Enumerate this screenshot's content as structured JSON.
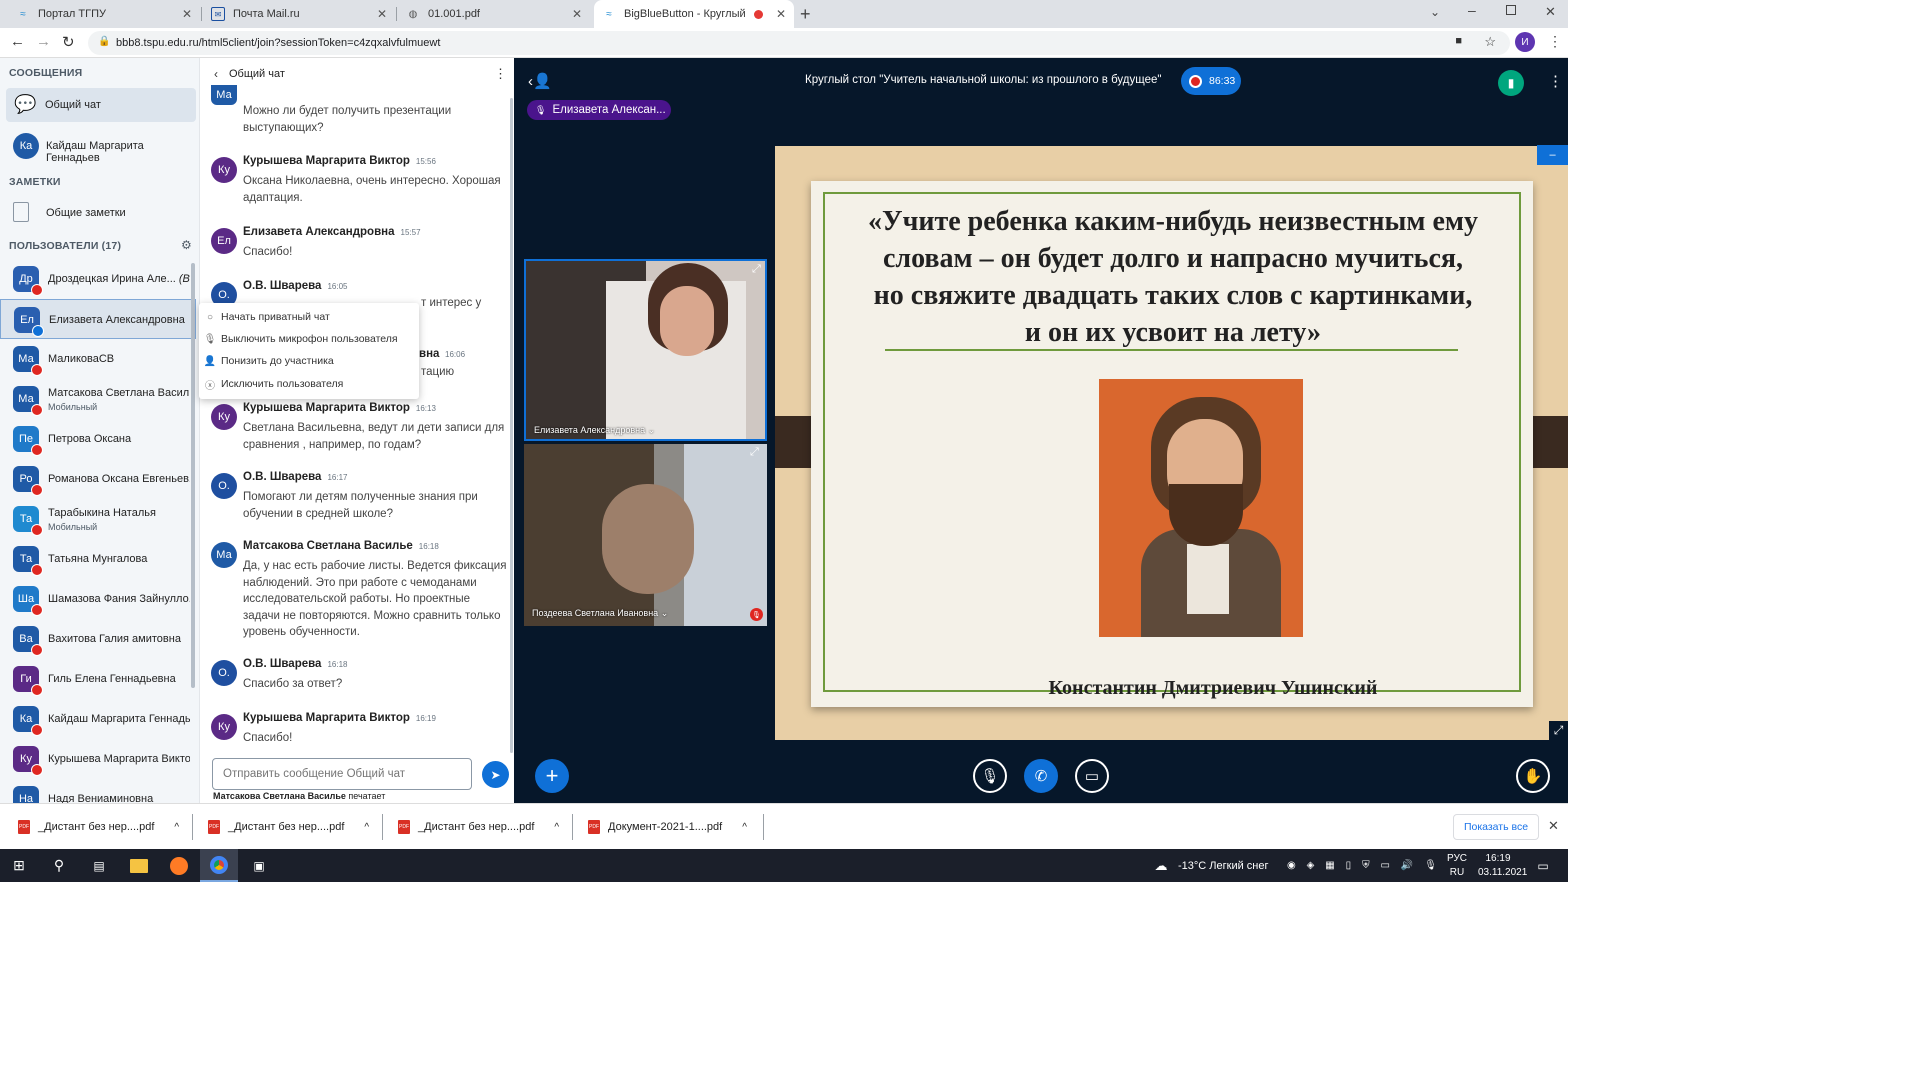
{
  "browser": {
    "tabs": [
      {
        "title": "Портал ТГПУ",
        "icon": "waves-icon",
        "active": false
      },
      {
        "title": "Почта Mail.ru",
        "icon": "mail-icon",
        "active": false
      },
      {
        "title": "01.001.pdf",
        "icon": "globe-icon",
        "active": false
      },
      {
        "title": "BigBlueButton - Круглый сто",
        "icon": "waves-icon",
        "active": true
      }
    ],
    "url": "bbb8.tspu.edu.ru/html5client/join?sessionToken=c4zqxalvfulmuewt",
    "profile_initial": "И"
  },
  "sidebar": {
    "messages_title": "СООБЩЕНИЯ",
    "public_chat_label": "Общий чат",
    "private_chat": {
      "initials": "Ка",
      "name": "Кайдаш Маргарита Геннадьев"
    },
    "notes_title": "ЗАМЕТКИ",
    "shared_notes_label": "Общие заметки",
    "users_title": "ПОЛЬЗОВАТЕЛИ (17)",
    "users": [
      {
        "initials": "Др",
        "name": "Дроздецкая Ирина Але...",
        "you": "(Вы)",
        "sub": "",
        "color": "#2a5fb0",
        "mic": "muted"
      },
      {
        "initials": "Ел",
        "name": "Елизавета Александровна",
        "you": "",
        "sub": "",
        "color": "#2a5fb0",
        "mic": "on"
      },
      {
        "initials": "Ма",
        "name": "МаликоваСВ",
        "you": "",
        "sub": "",
        "color": "#1f5aa6",
        "mic": "muted"
      },
      {
        "initials": "Ма",
        "name": "Матсакова Светлана Васил...",
        "you": "",
        "sub": "Мобильный",
        "color": "#1f5aa6",
        "mic": "muted"
      },
      {
        "initials": "Пе",
        "name": "Петрова Оксана",
        "you": "",
        "sub": "",
        "color": "#1f7ac9",
        "mic": "muted"
      },
      {
        "initials": "Ро",
        "name": "Романова Оксана Евгеньев...",
        "you": "",
        "sub": "",
        "color": "#1f5aa6",
        "mic": "muted"
      },
      {
        "initials": "Та",
        "name": "Тарабыкина Наталья",
        "you": "",
        "sub": "Мобильный",
        "color": "#1f8ad0",
        "mic": "muted"
      },
      {
        "initials": "Та",
        "name": "Татьяна Мунгалова",
        "you": "",
        "sub": "",
        "color": "#1f5aa6",
        "mic": "muted"
      },
      {
        "initials": "Ша",
        "name": "Шамазова Фания Зайнулло...",
        "you": "",
        "sub": "",
        "color": "#1f7ac9",
        "mic": "muted"
      },
      {
        "initials": "Ва",
        "name": "Вахитова Галия амитовна",
        "you": "",
        "sub": "",
        "color": "#1f5aa6",
        "mic": "muted"
      },
      {
        "initials": "Ги",
        "name": "Гиль Елена Геннадьевна",
        "you": "",
        "sub": "",
        "color": "#5b2a86",
        "mic": "muted"
      },
      {
        "initials": "Ка",
        "name": "Кайдаш Маргарита Геннадь...",
        "you": "",
        "sub": "",
        "color": "#1f5aa6",
        "mic": "muted"
      },
      {
        "initials": "Ку",
        "name": "Курышева Маргарита Виктор",
        "you": "",
        "sub": "",
        "color": "#5b2a86",
        "mic": "muted"
      },
      {
        "initials": "На",
        "name": "Надя Вениаминовна",
        "you": "",
        "sub": "",
        "color": "#1f5aa6",
        "mic": "muted"
      }
    ]
  },
  "context_menu": {
    "items": [
      {
        "label": "Начать приватный чат",
        "icon": "chat-bubble-icon"
      },
      {
        "label": "Выключить микрофон пользователя",
        "icon": "mic-off-icon"
      },
      {
        "label": "Понизить до участника",
        "icon": "user-icon"
      },
      {
        "label": "Исключить пользователя",
        "icon": "remove-circle-icon"
      }
    ]
  },
  "chat": {
    "title": "Общий чат",
    "messages": [
      {
        "initials": "Ма",
        "name": "",
        "time": "",
        "text": "Можно ли будет получить презентации выступающих?",
        "color": "#1f5aa6"
      },
      {
        "initials": "Ку",
        "name": "Курышева Маргарита Виктор",
        "time": "15:56",
        "text": "Оксана Николаевна, очень интересно. Хорошая адаптация.",
        "color": "#5b2a86"
      },
      {
        "initials": "Ел",
        "name": "Елизавета Александровна",
        "time": "15:57",
        "text": "Спасибо!",
        "color": "#5b2a86"
      },
      {
        "initials": "О.",
        "name": "О.В. Шварева",
        "time": "16:05",
        "text": "",
        "color": "#1f4fa0"
      },
      {
        "initials": "Ку",
        "name": "Курышева Маргарита Виктор",
        "time": "16:13",
        "text": "Светлана Васильевна, ведут ли дети записи для сравнения , например, по годам?",
        "color": "#5b2a86"
      },
      {
        "initials": "О.",
        "name": "О.В. Шварева",
        "time": "16:17",
        "text": "Помогают ли детям полученные знания при обучении в средней школе?",
        "color": "#1f4fa0"
      },
      {
        "initials": "Ма",
        "name": "Матсакова Светлана Василье",
        "time": "16:18",
        "text": "Да, у нас есть рабочие листы. Ведется фиксация наблюдений. Это при работе с чемоданами исследовательской работы. Но проектные задачи не повторяются. Можно сравнить только уровень обученности.",
        "color": "#1f5aa6"
      },
      {
        "initials": "О.",
        "name": "О.В. Шварева",
        "time": "16:18",
        "text": "Спасибо за ответ?",
        "color": "#1f4fa0"
      },
      {
        "initials": "Ку",
        "name": "Курышева Маргарита Виктор",
        "time": "16:19",
        "text": "Спасибо!",
        "color": "#5b2a86"
      }
    ],
    "hidden_fragments": [
      "т интерес у",
      "вна",
      "16:06",
      "тацию"
    ],
    "input_placeholder": "Отправить сообщение Общий чат",
    "typing": "Матсакова Светлана Василье",
    "typing_suffix": "печатает"
  },
  "meeting": {
    "title": "Круглый стол \"Учитель начальной школы: из прошлого в будущее\"",
    "timer": "86:33",
    "speaker": "Елизавета Алексан...",
    "videos": [
      {
        "name": "Елизавета Александровна",
        "muted": false
      },
      {
        "name": "Поздеева Светлана Ивановна",
        "muted": true
      }
    ],
    "slide": {
      "quote": "«Учите ребенка каким-нибудь неизвестным ему словам – он будет долго и напрасно мучиться, но свяжите двадцать таких слов с картинками, и он их усвоит на лету»",
      "quote_lines": [
        "«Учите ребенка каким-нибудь неизвестным ему",
        "словам – он будет долго и напрасно мучиться,",
        "но свяжите двадцать  таких слов с картинками,",
        "и он их усвоит на лету»"
      ],
      "author": "Константин Дмитриевич Ушинский"
    }
  },
  "downloads": {
    "items": [
      "_Дистант без нер....pdf",
      "_Дистант без нер....pdf",
      "_Дистант без нер....pdf",
      "Документ-2021-1....pdf"
    ],
    "show_all": "Показать все"
  },
  "taskbar": {
    "weather": "-13°C  Легкий снег",
    "lang": "РУС",
    "lang2": "RU",
    "time": "16:19",
    "date": "03.11.2021"
  }
}
